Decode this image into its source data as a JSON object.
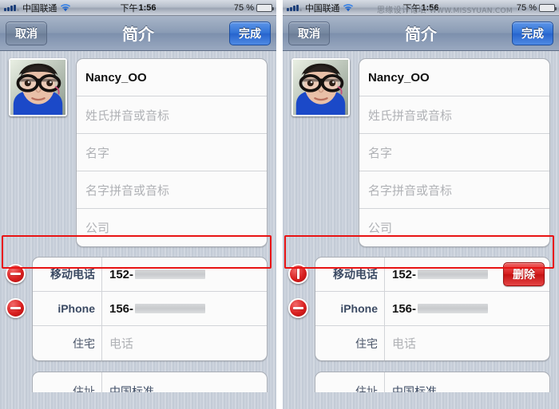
{
  "status_bar": {
    "carrier": "中国联通",
    "signal_icon": "signal-bars-icon",
    "wifi_icon": "wifi-icon",
    "time_ampm": "下午",
    "time": "1:56",
    "battery_percent": "75 %",
    "battery_level": 75,
    "battery_icon": "battery-icon"
  },
  "nav": {
    "cancel_label": "取消",
    "title": "简介",
    "done_label": "完成"
  },
  "watermark": {
    "text": "思缘设计论坛",
    "url": "WWW.MISSYUAN.COM"
  },
  "avatar": {
    "name": "contact-photo"
  },
  "name_card": {
    "rows": [
      {
        "value": "Nancy_OO",
        "placeholder": "",
        "filled": true
      },
      {
        "value": "",
        "placeholder": "姓氏拼音或音标",
        "filled": false
      },
      {
        "value": "",
        "placeholder": "名字",
        "filled": false
      },
      {
        "value": "",
        "placeholder": "名字拼音或音标",
        "filled": false
      },
      {
        "value": "",
        "placeholder": "公司",
        "filled": false
      }
    ]
  },
  "phone_card": {
    "rows": [
      {
        "label": "移动电话",
        "value": "152-",
        "redacted": true,
        "redact_width": 88,
        "has_handle": true,
        "placeholder": ""
      },
      {
        "label": "iPhone",
        "value": "156-",
        "redacted": true,
        "redact_width": 88,
        "has_handle": true,
        "placeholder": ""
      },
      {
        "label": "住宅",
        "value": "",
        "redacted": false,
        "redact_width": 0,
        "has_handle": false,
        "placeholder": "电话"
      }
    ]
  },
  "bottom_card": {
    "label": "住址",
    "value": "中国标准"
  },
  "left_panel": {
    "name": "step-1-swipe-state",
    "delete_button_visible": false,
    "handle_rotated": false
  },
  "right_panel": {
    "name": "step-2-delete-confirm-state",
    "delete_button_visible": true,
    "delete_label": "删除",
    "handle_rotated": true
  },
  "colors": {
    "accent_blue": "#3172d6",
    "danger_red": "#d61f1f",
    "annotation_red": "#e81313",
    "nav_bar": "#8b9cb5",
    "card_bg": "#fbfbfb",
    "background_stripe": "#c6cdd8"
  }
}
